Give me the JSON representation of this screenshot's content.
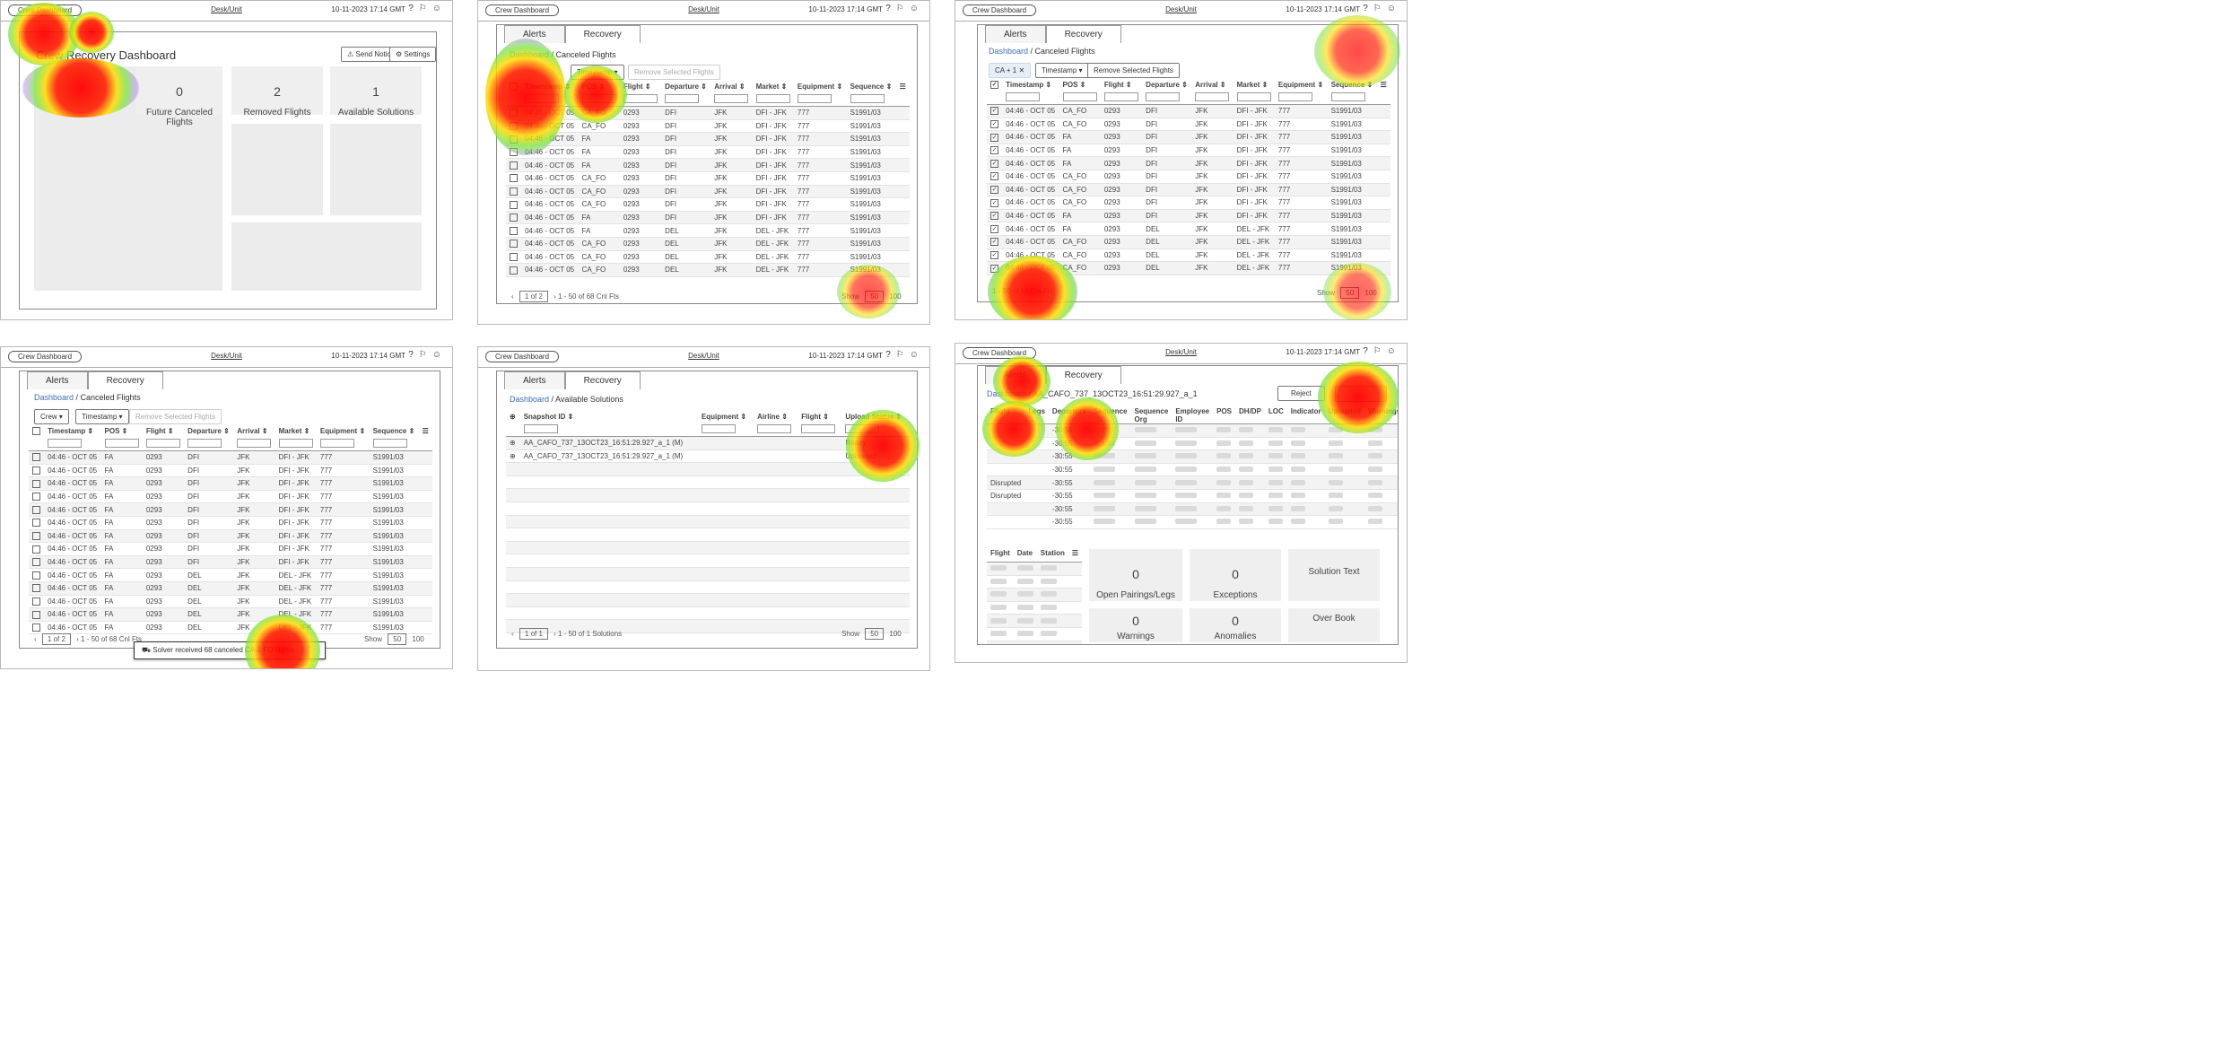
{
  "topbar": {
    "app": "Crew Dashboard",
    "location": "Desk/Unit",
    "datetime": "10-11-2023 17:14 GMT"
  },
  "tabs": {
    "alerts": "Alerts",
    "recovery": "Recovery"
  },
  "p1": {
    "title": "Crew Recovery Dashboard",
    "send_notice": "Send Notice",
    "settings": "Settings",
    "cards": [
      {
        "n": "0",
        "l": "Future Canceled Flights"
      },
      {
        "n": "2",
        "l": "Removed Flights"
      },
      {
        "n": "1",
        "l": "Available Solutions"
      }
    ]
  },
  "crumbs": {
    "dashboard": "Dashboard",
    "canceled": " / Canceled Flights",
    "available": " / Available Solutions",
    "solution": " / AA_CAFO_737_13OCT23_16:51:29.927_a_1"
  },
  "filters": {
    "timestamp": "Timestamp",
    "remove": "Remove Selected Flights",
    "ca": "CA + 1",
    "crew": "Crew"
  },
  "cols": [
    "Timestamp",
    "POS",
    "Flight",
    "Departure",
    "Arrival",
    "Market",
    "Equipment",
    "Sequence"
  ],
  "rows_p2": [
    [
      "04:46 - OCT 05",
      "CA_FO",
      "0293",
      "DFI",
      "JFK",
      "DFI - JFK",
      "777",
      "S1991/03"
    ],
    [
      "04:46 - OCT 05",
      "CA_FO",
      "0293",
      "DFI",
      "JFK",
      "DFI - JFK",
      "777",
      "S1991/03"
    ],
    [
      "04:46 - OCT 05",
      "FA",
      "0293",
      "DFI",
      "JFK",
      "DFI - JFK",
      "777",
      "S1991/03"
    ],
    [
      "04:46 - OCT 05",
      "FA",
      "0293",
      "DFI",
      "JFK",
      "DFI - JFK",
      "777",
      "S1991/03"
    ],
    [
      "04:46 - OCT 05",
      "FA",
      "0293",
      "DFI",
      "JFK",
      "DFI - JFK",
      "777",
      "S1991/03"
    ],
    [
      "04:46 - OCT 05",
      "CA_FO",
      "0293",
      "DFI",
      "JFK",
      "DFI - JFK",
      "777",
      "S1991/03"
    ],
    [
      "04:46 - OCT 05",
      "CA_FO",
      "0293",
      "DFI",
      "JFK",
      "DFI - JFK",
      "777",
      "S1991/03"
    ],
    [
      "04:46 - OCT 05",
      "CA_FO",
      "0293",
      "DFI",
      "JFK",
      "DFI - JFK",
      "777",
      "S1991/03"
    ],
    [
      "04:46 - OCT 05",
      "FA",
      "0293",
      "DFI",
      "JFK",
      "DFI - JFK",
      "777",
      "S1991/03"
    ],
    [
      "04:46 - OCT 05",
      "FA",
      "0293",
      "DEL",
      "JFK",
      "DEL - JFK",
      "777",
      "S1991/03"
    ],
    [
      "04:46 - OCT 05",
      "CA_FO",
      "0293",
      "DEL",
      "JFK",
      "DEL - JFK",
      "777",
      "S1991/03"
    ],
    [
      "04:46 - OCT 05",
      "CA_FO",
      "0293",
      "DEL",
      "JFK",
      "DEL - JFK",
      "777",
      "S1991/03"
    ],
    [
      "04:46 - OCT 05",
      "CA_FO",
      "0293",
      "DEL",
      "JFK",
      "DEL - JFK",
      "777",
      "S1991/03"
    ]
  ],
  "rows_p4": [
    [
      "04:46 - OCT 05",
      "FA",
      "0293",
      "DFI",
      "JFK",
      "DFI - JFK",
      "777",
      "S1991/03"
    ],
    [
      "04:46 - OCT 05",
      "FA",
      "0293",
      "DFI",
      "JFK",
      "DFI - JFK",
      "777",
      "S1991/03"
    ],
    [
      "04:46 - OCT 05",
      "FA",
      "0293",
      "DFI",
      "JFK",
      "DFI - JFK",
      "777",
      "S1991/03"
    ],
    [
      "04:46 - OCT 05",
      "FA",
      "0293",
      "DFI",
      "JFK",
      "DFI - JFK",
      "777",
      "S1991/03"
    ],
    [
      "04:46 - OCT 05",
      "FA",
      "0293",
      "DFI",
      "JFK",
      "DFI - JFK",
      "777",
      "S1991/03"
    ],
    [
      "04:46 - OCT 05",
      "FA",
      "0293",
      "DFI",
      "JFK",
      "DFI - JFK",
      "777",
      "S1991/03"
    ],
    [
      "04:46 - OCT 05",
      "FA",
      "0293",
      "DFI",
      "JFK",
      "DFI - JFK",
      "777",
      "S1991/03"
    ],
    [
      "04:46 - OCT 05",
      "FA",
      "0293",
      "DFI",
      "JFK",
      "DFI - JFK",
      "777",
      "S1991/03"
    ],
    [
      "04:46 - OCT 05",
      "FA",
      "0293",
      "DFI",
      "JFK",
      "DFI - JFK",
      "777",
      "S1991/03"
    ],
    [
      "04:46 - OCT 05",
      "FA",
      "0293",
      "DEL",
      "JFK",
      "DEL - JFK",
      "777",
      "S1991/03"
    ],
    [
      "04:46 - OCT 05",
      "FA",
      "0293",
      "DEL",
      "JFK",
      "DEL - JFK",
      "777",
      "S1991/03"
    ],
    [
      "04:46 - OCT 05",
      "FA",
      "0293",
      "DEL",
      "JFK",
      "DEL - JFK",
      "777",
      "S1991/03"
    ],
    [
      "04:46 - OCT 05",
      "FA",
      "0293",
      "DEL",
      "JFK",
      "DEL - JFK",
      "777",
      "S1991/03"
    ],
    [
      "04:46 - OCT 05",
      "FA",
      "0293",
      "DEL",
      "JFK",
      "DEL - JFK",
      "777",
      "S1991/03"
    ]
  ],
  "pager": {
    "page": "1 of 2",
    "summary": "1 - 50 of 68 Cnl Fts",
    "show": "Show",
    "size": "50",
    "max": "100",
    "page_sol": "1 of 1",
    "summary_sol": "1 - 50 of 1 Solutions"
  },
  "toast": "Solver received 68 canceled CA & FO flights",
  "p5": {
    "cols": [
      "Snapshot ID",
      "Equipment",
      "Airline",
      "Flight",
      "Upload Status"
    ],
    "rows": [
      [
        "AA_CAFO_737_13OCT23_16:51:29.927_a_1 (M)",
        "Ready"
      ],
      [
        "AA_CAFO_737_13OCT23_16:51:29.927_a_1 (M)",
        "Uploaded"
      ]
    ]
  },
  "p6": {
    "reject": "Reject",
    "cols": [
      "Flight",
      "Legs",
      "Departure",
      "Sequence",
      "Sequence Org",
      "Employee ID",
      "POS",
      "DH/DP",
      "LOC",
      "Indicator",
      "Uploaded",
      "Warnings"
    ],
    "times": [
      "-30:55",
      "-30:55",
      "-30:55",
      "-30:55",
      "-30:55",
      "-30:55",
      "-30:55",
      "-30:55"
    ],
    "status": [
      "Disrupted",
      "Disrupted"
    ],
    "mini_cols": [
      "Flight",
      "Date",
      "Station"
    ],
    "cards": [
      {
        "n": "0",
        "l": "Open Pairings/Legs"
      },
      {
        "n": "0",
        "l": "Exceptions"
      },
      {
        "n": "",
        "l": "Solution Text"
      },
      {
        "n": "0",
        "l": "Warnings"
      },
      {
        "n": "0",
        "l": "Anomalies"
      },
      {
        "n": "",
        "l": "Over Book"
      }
    ]
  }
}
